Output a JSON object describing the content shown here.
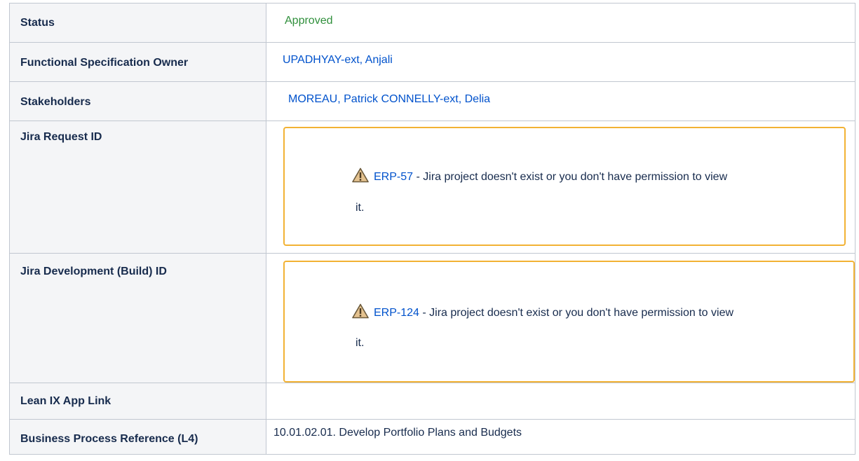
{
  "rows": [
    {
      "label": "Status",
      "value": "Approved"
    },
    {
      "label": "Functional Specification Owner",
      "value": "UPADHYAY-ext, Anjali"
    },
    {
      "label": "Stakeholders",
      "value": "MOREAU, Patrick CONNELLY-ext, Delia"
    },
    {
      "label": "Jira Request ID",
      "issue_key": "ERP-57",
      "message": "- Jira project doesn't exist or you don't have permission to view",
      "message_wrap": "it."
    },
    {
      "label": "Jira Development (Build) ID",
      "issue_key": "ERP-124",
      "message": "- Jira project doesn't exist or you don't have permission to view",
      "message_wrap": "it."
    },
    {
      "label": "Lean IX App Link",
      "value": ""
    },
    {
      "label": "Business Process Reference (L4)",
      "value": "10.01.02.01. Develop Portfolio Plans and Budgets"
    }
  ],
  "colors": {
    "border": "#c1c7d0",
    "key_bg": "#f4f5f7",
    "link": "#0052cc",
    "approved": "#2f8f3b",
    "warning_border": "#f2b234"
  },
  "icons": {
    "warning": "warning-icon"
  }
}
